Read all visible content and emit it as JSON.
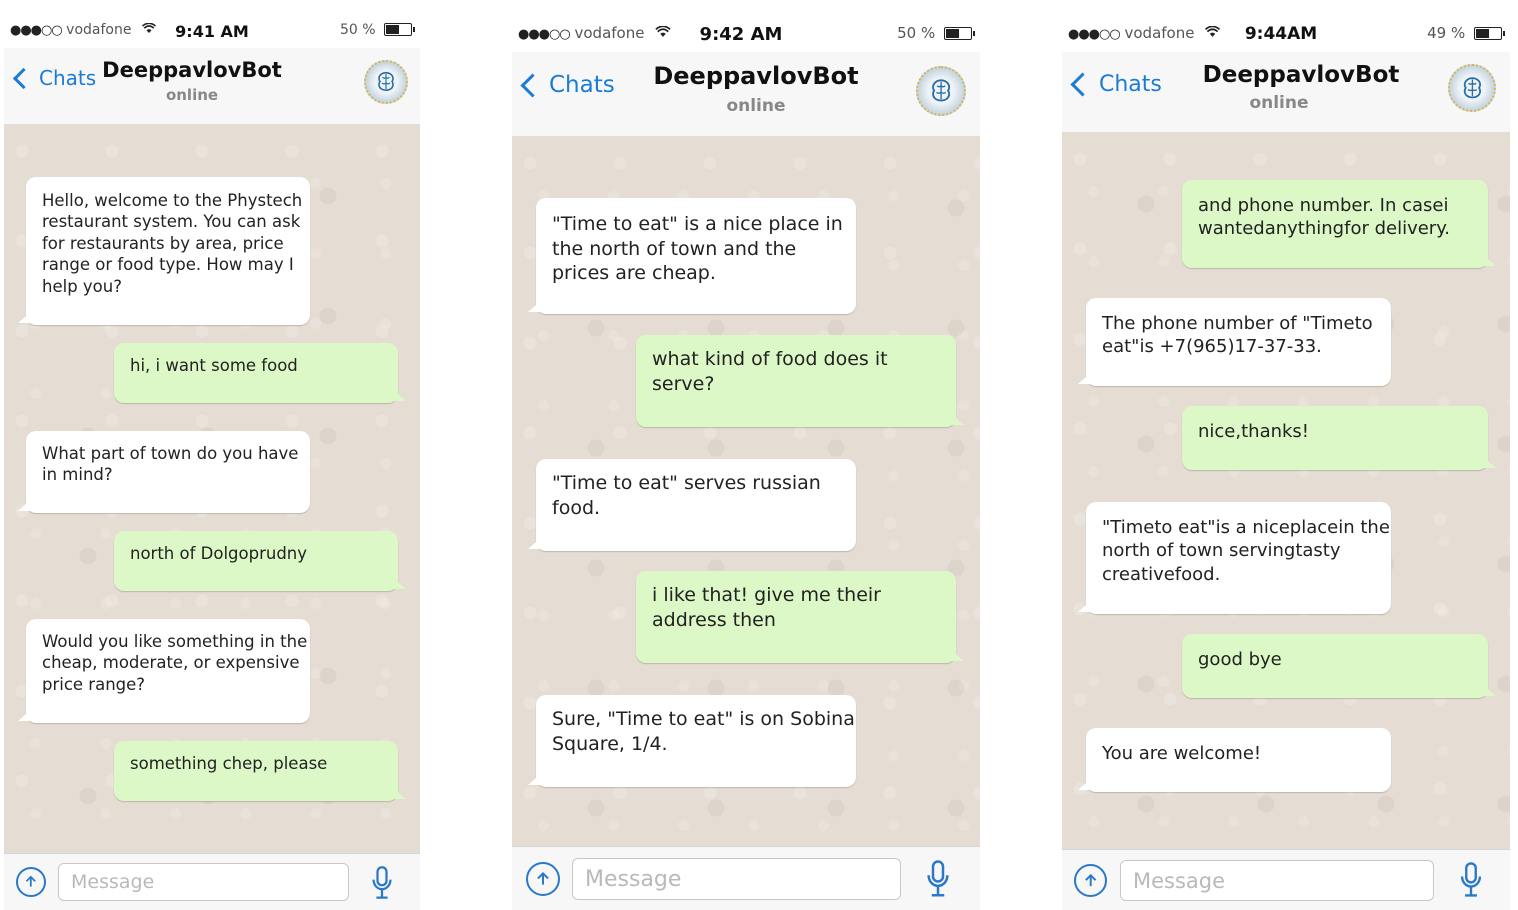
{
  "phones": [
    {
      "status": {
        "signal": "●●●○○",
        "carrier": "vodafone",
        "time": "9:41 AM",
        "battery": "50 %",
        "battery_level": 0.5
      },
      "header": {
        "back_label": "Chats",
        "title": "DeeppavlovBot",
        "subtitle": "online"
      },
      "messages": [
        {
          "from": "bot",
          "text": "Hello, welcome to the Phystech restaurant system. You can ask for restaurants by area, price range or food type. How may I help you?"
        },
        {
          "from": "user",
          "text": "hi, i want some food"
        },
        {
          "from": "bot",
          "text": "What part of town do you have in mind?"
        },
        {
          "from": "user",
          "text": "north of Dolgoprudny"
        },
        {
          "from": "bot",
          "text": "Would you like something in the cheap, moderate, or expensive price range?"
        },
        {
          "from": "user",
          "text": "something chep, please"
        }
      ],
      "input": {
        "placeholder": "Message"
      }
    },
    {
      "status": {
        "signal": "●●●○○",
        "carrier": "vodafone",
        "time": "9:42 AM",
        "battery": "50 %",
        "battery_level": 0.5
      },
      "header": {
        "back_label": "Chats",
        "title": "DeeppavlovBot",
        "subtitle": "online"
      },
      "messages": [
        {
          "from": "bot",
          "text": "\"Time to eat\" is a nice place in the north of town and the prices are cheap."
        },
        {
          "from": "user",
          "text": "what kind of food does it serve?"
        },
        {
          "from": "bot",
          "text": "\"Time to eat\" serves russian food."
        },
        {
          "from": "user",
          "text": "i like that! give me their address then"
        },
        {
          "from": "bot",
          "text": "Sure, \"Time to eat\" is on Sobina Square, 1/4."
        }
      ],
      "input": {
        "placeholder": "Message"
      }
    },
    {
      "status": {
        "signal": "●●●○○",
        "carrier": "vodafone",
        "time": "9:44AM",
        "battery": "49 %",
        "battery_level": 0.49
      },
      "header": {
        "back_label": "Chats",
        "title": "DeeppavlovBot",
        "subtitle": "online"
      },
      "messages": [
        {
          "from": "user",
          "text": "and phone number. In casei wantedanythingfor delivery."
        },
        {
          "from": "bot",
          "text": "The phone number of \"Timeto eat\"is +7(965)17-37-33."
        },
        {
          "from": "user",
          "text": "nice,thanks!"
        },
        {
          "from": "bot",
          "text": "\"Timeto eat\"is a niceplacein the north of town servingtasty creativefood."
        },
        {
          "from": "user",
          "text": "good bye"
        },
        {
          "from": "bot",
          "text": "You are welcome!"
        }
      ],
      "input": {
        "placeholder": "Message"
      }
    }
  ],
  "icons": {
    "back": "chevron-left-icon",
    "avatar": "brain-avatar-icon",
    "upload": "arrow-up-circle-icon",
    "mic": "microphone-icon",
    "wifi": "wifi-icon",
    "battery": "battery-icon"
  },
  "colors": {
    "accent": "#1a7bd8",
    "outgoing_bubble": "#dcf8c6",
    "incoming_bubble": "#ffffff",
    "chat_background": "#e5ddd3"
  }
}
